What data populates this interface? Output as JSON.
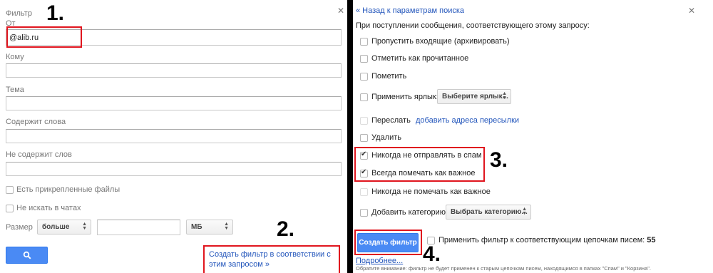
{
  "left": {
    "title": "Фильтр",
    "from_label": "От",
    "from_value": "@alib.ru",
    "to_label": "Кому",
    "subject_label": "Тема",
    "has_words_label": "Содержит слова",
    "no_words_label": "Не содержит слов",
    "attachments_label": "Есть прикрепленные файлы",
    "no_chats_label": "Не искать в чатах",
    "size_label": "Размер",
    "size_op": "больше",
    "size_unit": "МБ",
    "create_link": "Создать фильтр в соответствии с этим запросом »",
    "search_icon": "search-icon"
  },
  "right": {
    "back_link": "« Назад к параметрам поиска",
    "intro": "При поступлении сообщения, соответствующего этому запросу:",
    "skip_inbox": "Пропустить входящие (архивировать)",
    "mark_read": "Отметить как прочитанное",
    "star": "Пометить",
    "apply_label": "Применить ярлык:",
    "choose_label": "Выберите ярлык...",
    "forward": "Переслать",
    "add_forward": "добавить адреса пересылки",
    "delete": "Удалить",
    "never_spam": "Никогда не отправлять в спам",
    "always_important": "Всегда помечать как важное",
    "never_important": "Никогда не помечать как важное",
    "add_category": "Добавить категорию:",
    "choose_category": "Выбрать категорию...",
    "create_button": "Создать фильтр",
    "apply_threads": "Применить фильтр к соответствующим цепочкам писем:",
    "thread_count": "55",
    "more_link": "Подробнее...",
    "note": "Обратите внимание: фильтр не будет применен к старым цепочкам писем, находящимся в папках \"Спам\" и \"Корзина\"."
  },
  "annotations": {
    "step1": "1.",
    "step2": "2.",
    "step3": "3.",
    "step4": "4.",
    "color": "#e0151e"
  },
  "colors": {
    "link": "#2255bb",
    "button": "#4a8af4"
  }
}
